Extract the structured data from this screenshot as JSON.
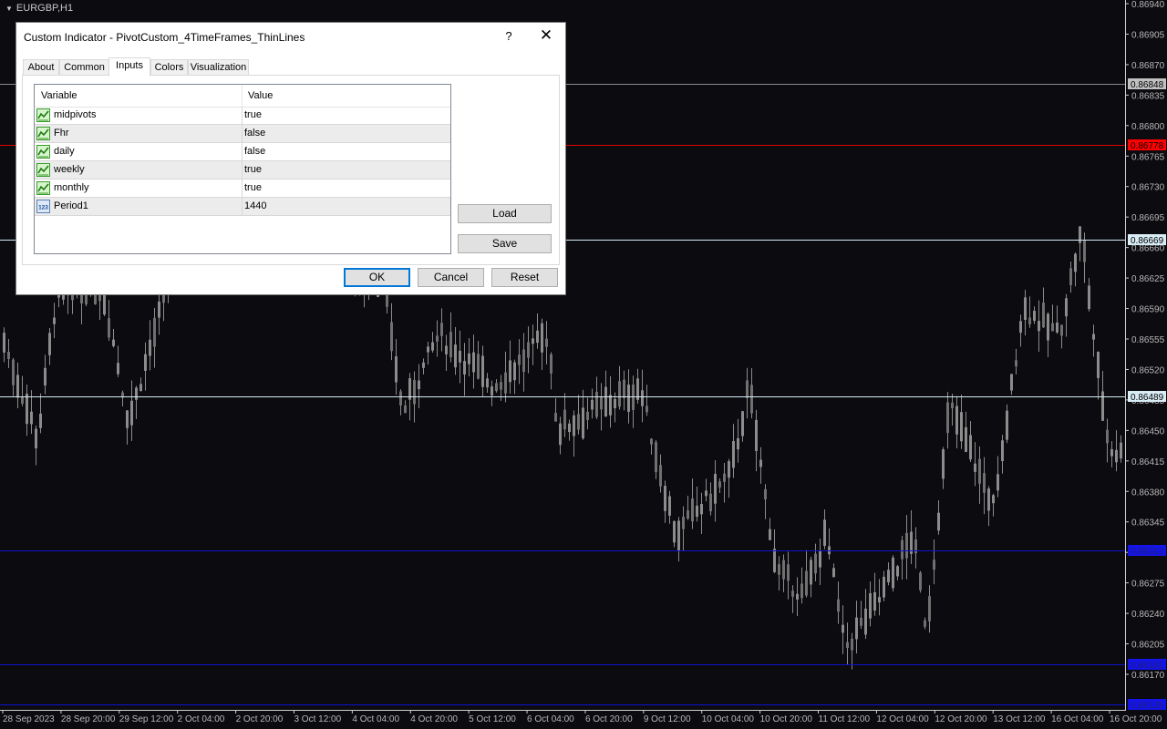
{
  "chart": {
    "symbol": "EURGBP,H1",
    "price_axis": [
      "0.86940",
      "0.86905",
      "0.86870",
      "0.86835",
      "0.86800",
      "0.86765",
      "0.86730",
      "0.86695",
      "0.86660",
      "0.86625",
      "0.86590",
      "0.86555",
      "0.86520",
      "0.86485",
      "0.86450",
      "0.86415",
      "0.86380",
      "0.86345",
      "0.86310",
      "0.86275",
      "0.86240",
      "0.86205",
      "0.86170"
    ],
    "time_axis": [
      "28 Sep 2023",
      "28 Sep 20:00",
      "29 Sep 12:00",
      "2 Oct 04:00",
      "2 Oct 20:00",
      "3 Oct 12:00",
      "4 Oct 04:00",
      "4 Oct 20:00",
      "5 Oct 12:00",
      "6 Oct 04:00",
      "6 Oct 20:00",
      "9 Oct 12:00",
      "10 Oct 04:00",
      "10 Oct 20:00",
      "11 Oct 12:00",
      "12 Oct 04:00",
      "12 Oct 20:00",
      "13 Oct 12:00",
      "16 Oct 04:00",
      "16 Oct 20:00"
    ],
    "level_lines": [
      {
        "price": "0.86848",
        "color": "#8a8a8a",
        "tag_bg": "#c0c0c0",
        "tag_fg": "#000000"
      },
      {
        "price": "0.86778",
        "color": "#e00000",
        "tag_bg": "#ff0000",
        "tag_fg": "#000000"
      },
      {
        "price": "0.86669",
        "color": "#d8ecf5",
        "tag_bg": "#d8ecf5",
        "tag_fg": "#000000"
      },
      {
        "price": "0.86489",
        "color": "#d8ecf5",
        "tag_bg": "#d8ecf5",
        "tag_fg": "#000000"
      },
      {
        "price": "0.86312",
        "color": "#1010d0",
        "tag_bg": "#1414e6",
        "tag_fg": "#1f1f7a"
      },
      {
        "price": "0.86181",
        "color": "#1010d0",
        "tag_bg": "#1414e6",
        "tag_fg": "#1f1f7a"
      },
      {
        "price": "0.86135",
        "color": "#1010d0",
        "tag_bg": "#1414e6",
        "tag_fg": "#1f1f7a"
      }
    ],
    "candle_color": "#8c8c8c"
  },
  "dialog": {
    "title": "Custom Indicator - PivotCustom_4TimeFrames_ThinLines",
    "help": "?",
    "close": "✕",
    "tabs": [
      "About",
      "Common",
      "Inputs",
      "Colors",
      "Visualization"
    ],
    "active_tab": "Inputs",
    "grid": {
      "col_variable": "Variable",
      "col_value": "Value",
      "rows": [
        {
          "name": "midpivots",
          "value": "true",
          "icon": "bool-icon"
        },
        {
          "name": "Fhr",
          "value": "false",
          "icon": "bool-icon"
        },
        {
          "name": "daily",
          "value": "false",
          "icon": "bool-icon"
        },
        {
          "name": "weekly",
          "value": "true",
          "icon": "bool-icon"
        },
        {
          "name": "monthly",
          "value": "true",
          "icon": "bool-icon"
        },
        {
          "name": "Period1",
          "value": "1440",
          "icon": "integer-icon"
        }
      ]
    },
    "load_label": "Load",
    "save_label": "Save",
    "ok_label": "OK",
    "cancel_label": "Cancel",
    "reset_label": "Reset"
  }
}
